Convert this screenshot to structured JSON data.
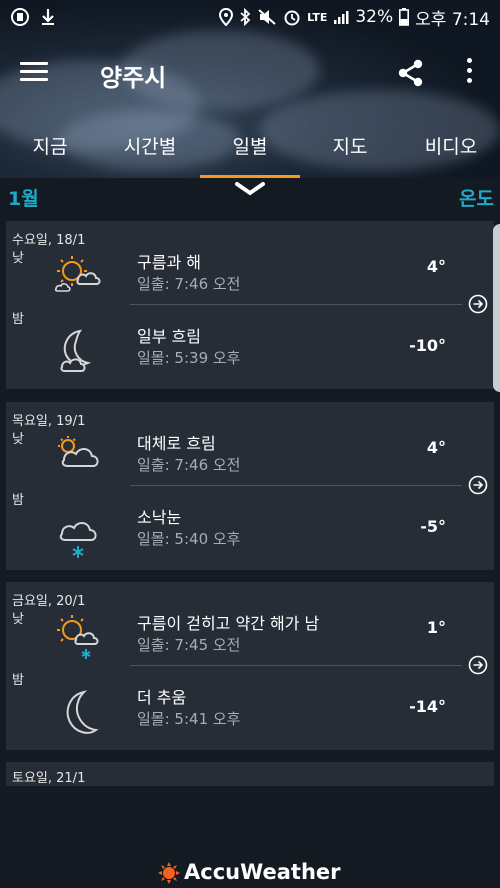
{
  "status_bar": {
    "battery": "32%",
    "time": "오후 7:14",
    "network": "LTE"
  },
  "app_bar": {
    "title": "양주시"
  },
  "tabs": [
    {
      "label": "지금"
    },
    {
      "label": "시간별"
    },
    {
      "label": "일별"
    },
    {
      "label": "지도"
    },
    {
      "label": "비디오"
    }
  ],
  "subheader": {
    "month": "1월",
    "unit": "온도"
  },
  "days": [
    {
      "date": "수요일, 18/1",
      "day": {
        "label": "낮",
        "condition": "구름과 해",
        "sun_time": "일출: 7:46 오전",
        "temp": "4°"
      },
      "night": {
        "label": "밤",
        "condition": "일부 흐림",
        "sun_time": "일몰: 5:39 오후",
        "temp": "-10°"
      }
    },
    {
      "date": "목요일, 19/1",
      "day": {
        "label": "낮",
        "condition": "대체로 흐림",
        "sun_time": "일출: 7:46 오전",
        "temp": "4°"
      },
      "night": {
        "label": "밤",
        "condition": "소낙눈",
        "sun_time": "일몰: 5:40 오후",
        "temp": "-5°"
      }
    },
    {
      "date": "금요일, 20/1",
      "day": {
        "label": "낮",
        "condition": "구름이 걷히고 약간 해가 남",
        "sun_time": "일출: 7:45 오전",
        "temp": "1°"
      },
      "night": {
        "label": "밤",
        "condition": "더 추움",
        "sun_time": "일몰: 5:41 오후",
        "temp": "-14°"
      }
    },
    {
      "date": "토요일, 21/1"
    }
  ],
  "footer": {
    "brand": "AccuWeather"
  },
  "colors": {
    "accent": "#1eaac8",
    "tab_indicator": "#f39a1e",
    "sun": "#f39a1e",
    "snow": "#1eaac8"
  }
}
